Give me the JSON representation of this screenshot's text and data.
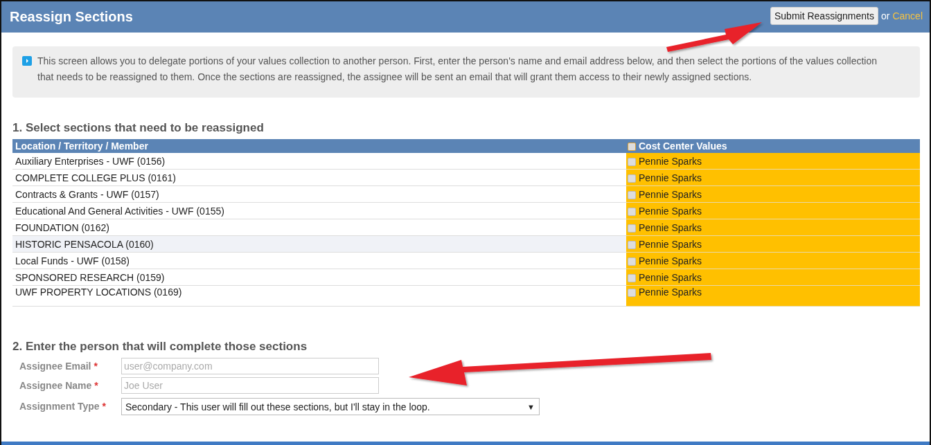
{
  "header": {
    "title": "Reassign Sections",
    "submit_button": "Submit Reassignments",
    "or_text": "or",
    "cancel_link": "Cancel"
  },
  "info": {
    "text": "This screen allows you to delegate portions of your values collection to another person. First, enter the person's name and email address below, and then select the portions of the values collection that needs to be reassigned to them. Once the sections are reassigned, the assignee will be sent an email that will grant them access to their newly assigned sections."
  },
  "section_1": {
    "heading": "1. Select sections that need to be reassigned",
    "table": {
      "columns": [
        {
          "label": "Location / Territory / Member"
        },
        {
          "label": "Cost Center Values",
          "checked": false
        }
      ],
      "rows": [
        {
          "name": "Auxiliary Enterprises - UWF (0156)",
          "value": "Pennie Sparks",
          "checked": false,
          "hovered": false
        },
        {
          "name": "COMPLETE COLLEGE PLUS (0161)",
          "value": "Pennie Sparks",
          "checked": false,
          "hovered": false
        },
        {
          "name": "Contracts & Grants - UWF (0157)",
          "value": "Pennie Sparks",
          "checked": false,
          "hovered": false
        },
        {
          "name": "Educational And General Activities - UWF (0155)",
          "value": "Pennie Sparks",
          "checked": false,
          "hovered": false
        },
        {
          "name": "FOUNDATION (0162)",
          "value": "Pennie Sparks",
          "checked": false,
          "hovered": false
        },
        {
          "name": "HISTORIC PENSACOLA (0160)",
          "value": "Pennie Sparks",
          "checked": false,
          "hovered": true
        },
        {
          "name": "Local Funds - UWF (0158)",
          "value": "Pennie Sparks",
          "checked": false,
          "hovered": false
        },
        {
          "name": "SPONSORED RESEARCH (0159)",
          "value": "Pennie Sparks",
          "checked": false,
          "hovered": false
        },
        {
          "name": "UWF PROPERTY LOCATIONS (0169)",
          "value": "Pennie Sparks",
          "checked": false,
          "hovered": false
        }
      ]
    }
  },
  "section_2": {
    "heading": "2. Enter the person that will complete those sections",
    "fields": [
      {
        "kind": "text",
        "label": "Assignee Email",
        "required_mark": "*",
        "placeholder": "user@company.com"
      },
      {
        "kind": "text",
        "label": "Assignee Name",
        "required_mark": "*",
        "placeholder": "Joe User"
      },
      {
        "kind": "select",
        "label": "Assignment Type",
        "required_mark": "*",
        "value": "Secondary - This user will fill out these sections, but I'll stay in the loop.",
        "caret": "▼"
      }
    ]
  }
}
